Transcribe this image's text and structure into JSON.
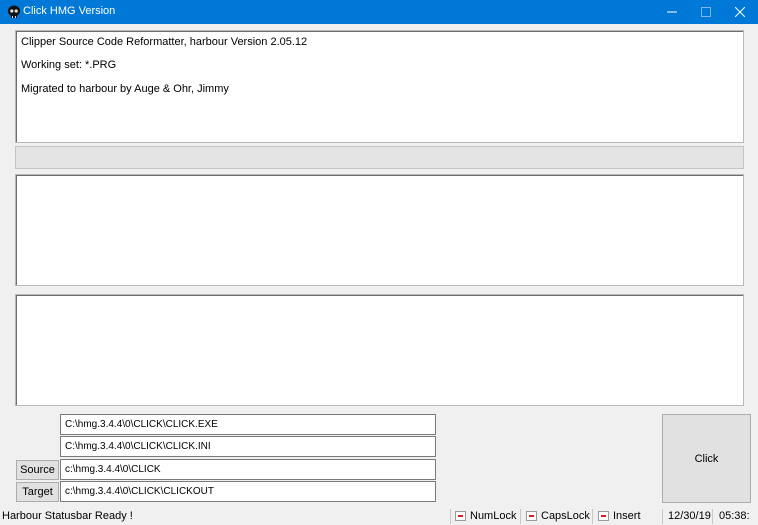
{
  "window": {
    "title": "Click HMG Version",
    "app_icon": "skull-icon",
    "controls": [
      "minimize-icon",
      "maximize-icon",
      "close-icon"
    ]
  },
  "info": {
    "line1": "Clipper Source Code Reformatter,  harbour Version 2.05.12",
    "line2": "Working set: *.PRG",
    "line3": "Migrated to harbour by Auge & Ohr, Jimmy"
  },
  "paths": {
    "exe": "C:\\hmg.3.4.4\\0\\CLICK\\CLICK.EXE",
    "ini": "C:\\hmg.3.4.4\\0\\CLICK\\CLICK.INI",
    "source": "c:\\hmg.3.4.4\\0\\CLICK",
    "target": "c:\\hmg.3.4.4\\0\\CLICK\\CLICKOUT"
  },
  "buttons": {
    "source": "Source",
    "target": "Target",
    "click": "Click"
  },
  "statusbar": {
    "message": "Harbour Statusbar Ready !",
    "numlock": "NumLock",
    "capslock": "CapsLock",
    "insert": "Insert",
    "date": "12/30/19",
    "time": "05:38:"
  }
}
